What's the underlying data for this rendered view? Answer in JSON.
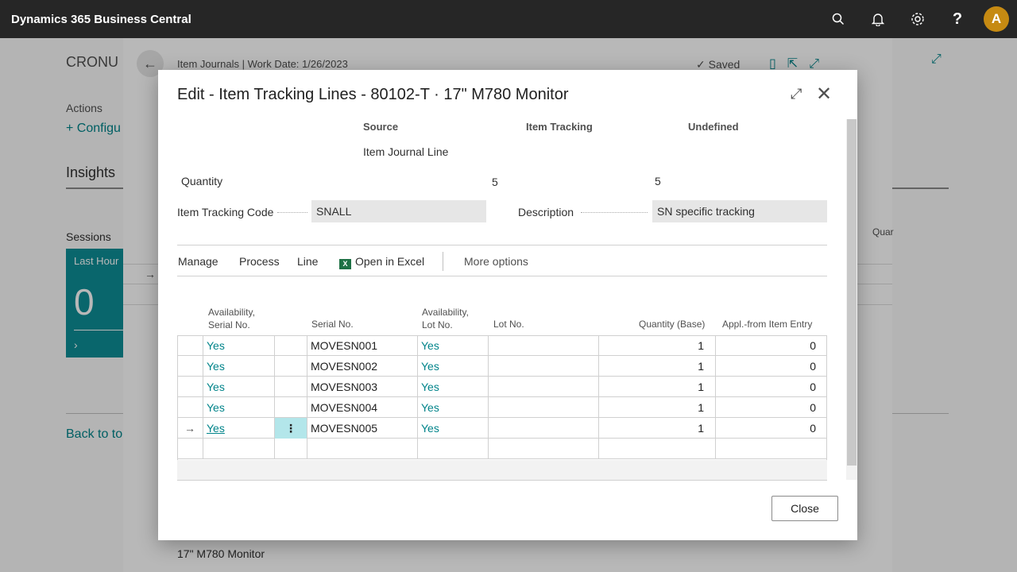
{
  "app": {
    "title": "Dynamics 365 Business Central",
    "avatar_letter": "A"
  },
  "topbar_icons": [
    "search-icon",
    "bell-icon",
    "gear-icon",
    "help-icon"
  ],
  "background": {
    "company": "CRONU",
    "actions_label": "Actions",
    "configure_link": "+ Configu",
    "insights": "Insights",
    "sessions": "Sessions",
    "tile": {
      "label": "Last Hour",
      "value": "0"
    },
    "back_link": "Back to to",
    "journal_title": "Item Journals | Work Date: 1/26/2023",
    "saved": "✓ Saved",
    "qua_col": "Quar",
    "monitor": "17\" M780 Monitor"
  },
  "dialog": {
    "title": "Edit - Item Tracking Lines - 80102-T · 17\" M780 Monitor",
    "header": {
      "source": "Source",
      "item_tracking": "Item Tracking",
      "undefined": "Undefined",
      "source_value": "Item Journal Line",
      "quantity_label": "Quantity",
      "quantity_item_tracking": "5",
      "quantity_undefined": "5"
    },
    "item_tracking_code_label": "Item Tracking Code",
    "item_tracking_code_value": "SNALL",
    "description_label": "Description",
    "description_value": "SN specific tracking",
    "toolbar": {
      "manage": "Manage",
      "process": "Process",
      "line": "Line",
      "open_in_excel": "Open in Excel",
      "more_options": "More options"
    },
    "columns": {
      "availability_serial_1": "Availability,",
      "availability_serial_2": "Serial No.",
      "serial_no": "Serial No.",
      "availability_lot_1": "Availability,",
      "availability_lot_2": "Lot No.",
      "lot_no": "Lot No.",
      "quantity_base": "Quantity (Base)",
      "appl_from_item_entry": "Appl.-from Item Entry"
    },
    "rows": [
      {
        "avail_serial": "Yes",
        "serial_no": "MOVESN001",
        "avail_lot": "Yes",
        "lot_no": "",
        "qty_base": "1",
        "appl_from": "0"
      },
      {
        "avail_serial": "Yes",
        "serial_no": "MOVESN002",
        "avail_lot": "Yes",
        "lot_no": "",
        "qty_base": "1",
        "appl_from": "0"
      },
      {
        "avail_serial": "Yes",
        "serial_no": "MOVESN003",
        "avail_lot": "Yes",
        "lot_no": "",
        "qty_base": "1",
        "appl_from": "0"
      },
      {
        "avail_serial": "Yes",
        "serial_no": "MOVESN004",
        "avail_lot": "Yes",
        "lot_no": "",
        "qty_base": "1",
        "appl_from": "0"
      },
      {
        "avail_serial": "Yes",
        "serial_no": "MOVESN005",
        "avail_lot": "Yes",
        "lot_no": "",
        "qty_base": "1",
        "appl_from": "0"
      }
    ],
    "close_button": "Close"
  },
  "colors": {
    "accent": "#00848a",
    "topbar": "#262626",
    "avatar": "#c68a12",
    "selected_cell": "#b3e6ea"
  }
}
